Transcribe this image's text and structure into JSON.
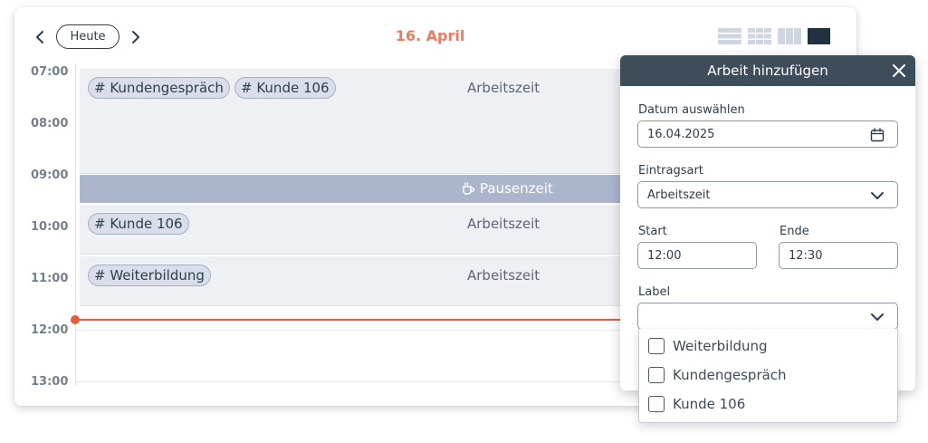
{
  "header": {
    "today_label": "Heute",
    "date_title": "16. April",
    "prev_icon": "chevron-left-icon",
    "next_icon": "chevron-right-icon",
    "view_icons": [
      "list-view-icon",
      "grid-view-icon",
      "columns-view-icon",
      "solid-view-icon"
    ]
  },
  "timeline": {
    "hours": [
      "07:00",
      "08:00",
      "09:00",
      "10:00",
      "11:00",
      "12:00",
      "13:00"
    ],
    "entries": [
      {
        "type": "Arbeitszeit",
        "tags": [
          "# Kundengespräch",
          "# Kunde 106"
        ]
      },
      {
        "type": "Pausenzeit",
        "icon": "coffee-cup-icon"
      },
      {
        "type": "Arbeitszeit",
        "tags": [
          "# Kunde 106"
        ]
      },
      {
        "type": "Arbeitszeit",
        "tags": [
          "# Weiterbildung"
        ]
      }
    ]
  },
  "modal": {
    "title": "Arbeit hinzufügen",
    "close_icon": "close-icon",
    "date_label": "Datum auswählen",
    "date_value": "16.04.2025",
    "type_label": "Eintragsart",
    "type_value": "Arbeitszeit",
    "start_label": "Start",
    "start_value": "12:00",
    "end_label": "Ende",
    "end_value": "12:30",
    "label_label": "Label",
    "label_value": "",
    "label_options": [
      "Weiterbildung",
      "Kundengespräch",
      "Kunde 106"
    ]
  },
  "colors": {
    "accent": "#f07a5f",
    "now_line": "#ea5a3d",
    "header_dark": "#3d4d5c",
    "pause_block": "#abb6cc",
    "tag_bg": "#d9deea"
  }
}
